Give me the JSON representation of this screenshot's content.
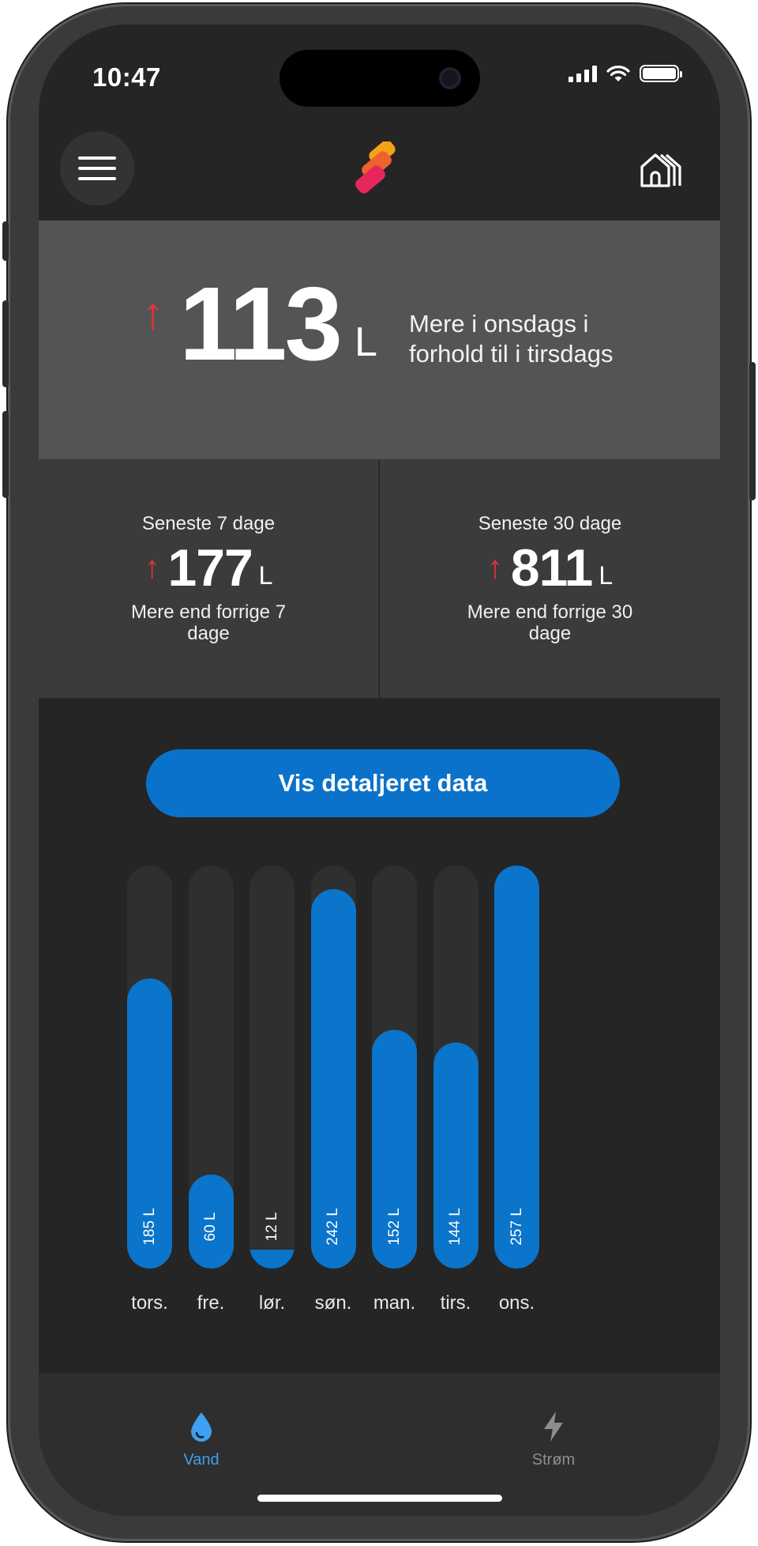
{
  "status": {
    "time": "10:47"
  },
  "header": {
    "menu_icon": "hamburger-icon",
    "logo": "app-logo",
    "home_icon": "home-icon"
  },
  "hero": {
    "arrow": "↑",
    "value": "113",
    "unit": "L",
    "text": "Mere i onsdags i forhold til i tirsdags"
  },
  "panels": [
    {
      "title": "Seneste 7 dage",
      "arrow": "↑",
      "value": "177",
      "unit": "L",
      "desc": "Mere end forrige 7 dage"
    },
    {
      "title": "Seneste 30 dage",
      "arrow": "↑",
      "value": "811",
      "unit": "L",
      "desc": "Mere end forrige 30 dage"
    }
  ],
  "detail_button": {
    "label": "Vis detaljeret data"
  },
  "chart_data": {
    "type": "bar",
    "categories": [
      "tors.",
      "fre.",
      "lør.",
      "søn.",
      "man.",
      "tirs.",
      "ons."
    ],
    "values": [
      185,
      60,
      12,
      242,
      152,
      144,
      257
    ],
    "value_labels": [
      "185 L",
      "60 L",
      "12 L",
      "242 L",
      "152 L",
      "144 L",
      "257 L"
    ],
    "ylim": [
      0,
      257
    ],
    "colors": {
      "bar": "#0b74cb",
      "track": "#2f2f2f"
    }
  },
  "tabs": [
    {
      "label": "Vand",
      "icon": "water-drop-icon",
      "active": true
    },
    {
      "label": "Strøm",
      "icon": "lightning-icon",
      "active": false
    }
  ],
  "colors": {
    "accent": "#0a72ca",
    "up_arrow": "#e0353d",
    "active_tab": "#3ea0f0",
    "inactive_tab": "#8e8e8e"
  }
}
